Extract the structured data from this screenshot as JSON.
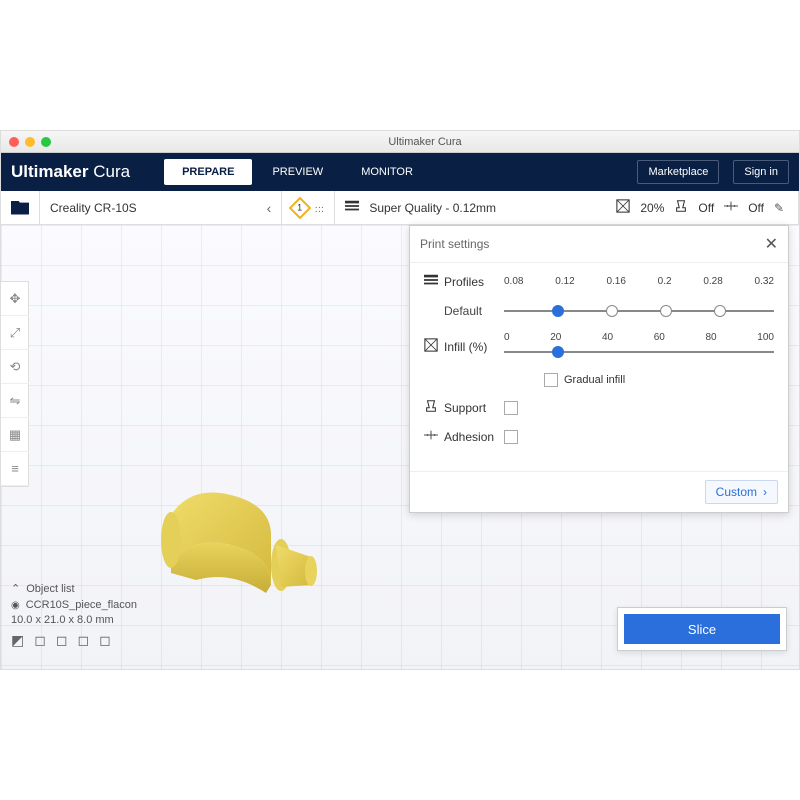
{
  "window": {
    "title": "Ultimaker Cura"
  },
  "logo": {
    "brand": "Ultimaker",
    "product": "Cura"
  },
  "tabs": {
    "prepare": "PREPARE",
    "preview": "PREVIEW",
    "monitor": "MONITOR"
  },
  "topbuttons": {
    "marketplace": "Marketplace",
    "signin": "Sign in"
  },
  "toolbar": {
    "printer": "Creality CR-10S",
    "config_badge": "1",
    "quality_label": "Super Quality - 0.12mm",
    "infill": "20%",
    "support": "Off",
    "adhesion": "Off"
  },
  "panel": {
    "title": "Print settings",
    "profiles_label": "Profiles",
    "default_label": "Default",
    "profile_ticks": [
      "0.08",
      "0.12",
      "0.16",
      "0.2",
      "0.28",
      "0.32"
    ],
    "profile_selected": "0.12",
    "infill_label": "Infill (%)",
    "infill_ticks": [
      "0",
      "20",
      "40",
      "60",
      "80",
      "100"
    ],
    "infill_value": "20",
    "gradual_label": "Gradual infill",
    "support_label": "Support",
    "adhesion_label": "Adhesion",
    "custom": "Custom"
  },
  "objectlist": {
    "header": "Object list",
    "item": "CCR10S_piece_flacon",
    "dims": "10.0 x 21.0 x 8.0 mm"
  },
  "slice": {
    "label": "Slice"
  }
}
